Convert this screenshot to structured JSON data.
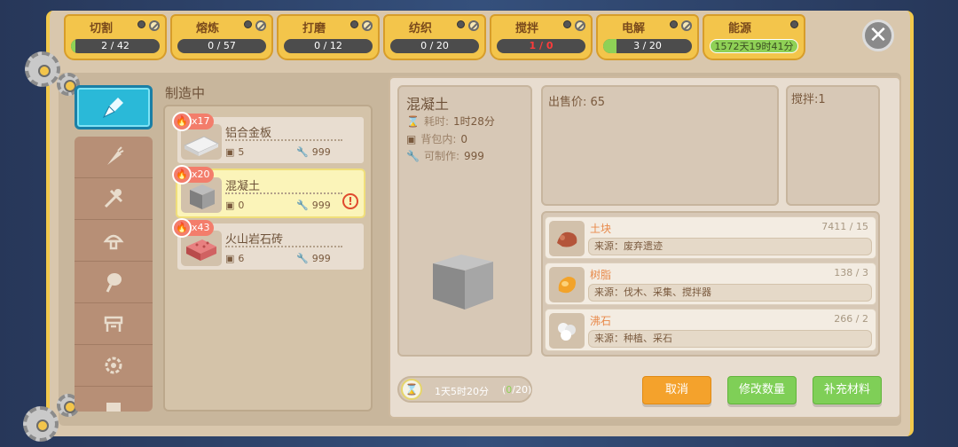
{
  "tabs": [
    {
      "label": "切割",
      "progress": "2 / 42",
      "fill": 0.05,
      "status": "normal"
    },
    {
      "label": "熔炼",
      "progress": "0 / 57",
      "fill": 0,
      "status": "normal"
    },
    {
      "label": "打磨",
      "progress": "0 / 12",
      "fill": 0,
      "status": "normal"
    },
    {
      "label": "纺织",
      "progress": "0 / 20",
      "fill": 0,
      "status": "normal"
    },
    {
      "label": "搅拌",
      "progress": "1 / 0",
      "fill": 0,
      "status": "alert"
    },
    {
      "label": "电解",
      "progress": "3 / 20",
      "fill": 0.15,
      "status": "normal"
    },
    {
      "label": "能源",
      "progress": "1572天19时41分",
      "fill": 1,
      "status": "energy"
    }
  ],
  "crafting": {
    "title": "制造中",
    "items": [
      {
        "name": "铝合金板",
        "qty": "x17",
        "stock": "5",
        "available": "999",
        "selected": false,
        "warning": false
      },
      {
        "name": "混凝土",
        "qty": "x20",
        "stock": "0",
        "available": "999",
        "selected": true,
        "warning": true
      },
      {
        "name": "火山岩石砖",
        "qty": "x43",
        "stock": "6",
        "available": "999",
        "selected": false,
        "warning": false
      }
    ]
  },
  "detail": {
    "title": "混凝土",
    "time_label": "耗时:",
    "time_value": "1时28分",
    "bag_label": "背包内:",
    "bag_value": "0",
    "craftable_label": "可制作:",
    "craftable_value": "999",
    "total_time": "1天5时20分",
    "count_open": "(",
    "count_done": "0",
    "count_rest": "/20)"
  },
  "sell_price": "出售价: 65",
  "mixer": "搅拌:1",
  "materials": [
    {
      "name": "土块",
      "count": "7411 / 15",
      "source": "来源：废弃遗迹"
    },
    {
      "name": "树脂",
      "count": "138 / 3",
      "source": "来源：伐木、采集、搅拌器"
    },
    {
      "name": "沸石",
      "count": "266 / 2",
      "source": "来源：种植、采石"
    }
  ],
  "buttons": {
    "cancel": "取消",
    "modify": "修改数量",
    "supply": "补充材料"
  },
  "colors": {
    "tab_yellow": "#f3c54b",
    "progress_green": "#8fd156",
    "alert_red": "#ff3b3b",
    "active_category": "#2ab9d8",
    "cancel_orange": "#f4a22c",
    "action_green": "#7fcf57"
  }
}
